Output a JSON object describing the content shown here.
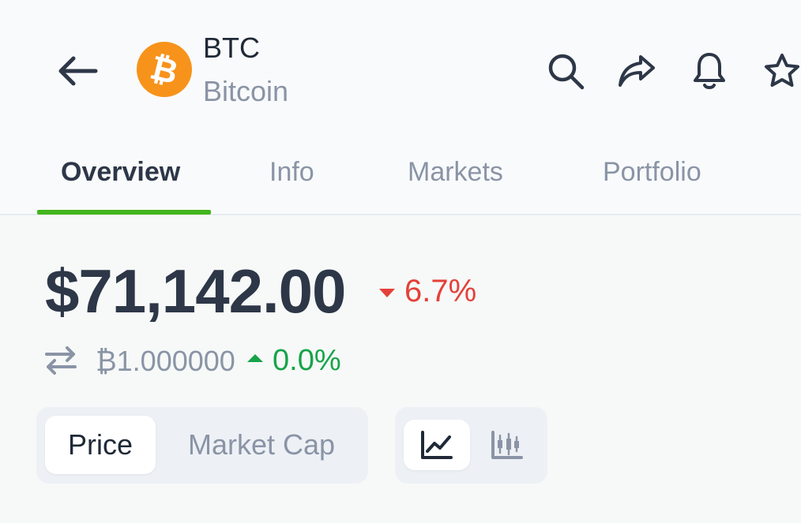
{
  "header": {
    "back_icon": "arrow-left-icon",
    "coin": {
      "symbol": "BTC",
      "name": "Bitcoin",
      "logo_icon": "bitcoin-logo-icon",
      "logo_color": "#f7931a"
    },
    "actions": [
      {
        "icon": "search-icon"
      },
      {
        "icon": "share-icon"
      },
      {
        "icon": "bell-icon"
      },
      {
        "icon": "star-icon"
      }
    ]
  },
  "tabs": [
    {
      "label": "Overview",
      "active": true
    },
    {
      "label": "Info",
      "active": false
    },
    {
      "label": "Markets",
      "active": false
    },
    {
      "label": "Portfolio",
      "active": false
    }
  ],
  "price": {
    "value": "$71,142.00",
    "change": "6.7%",
    "change_direction": "down",
    "change_color": "#e5403a"
  },
  "btc_price": {
    "value": "₿1.000000",
    "change": "0.0%",
    "change_direction": "up",
    "change_color": "#16a34a",
    "icon": "swap-arrows-icon"
  },
  "metric_toggle": {
    "options": [
      "Price",
      "Market Cap"
    ],
    "selected": "Price"
  },
  "chart_type_toggle": {
    "options": [
      {
        "icon": "line-chart-icon",
        "selected": true
      },
      {
        "icon": "candlestick-chart-icon",
        "selected": false
      }
    ]
  },
  "colors": {
    "accent": "#43b51d",
    "text_primary": "#2d3748",
    "text_muted": "#8a94a6"
  }
}
